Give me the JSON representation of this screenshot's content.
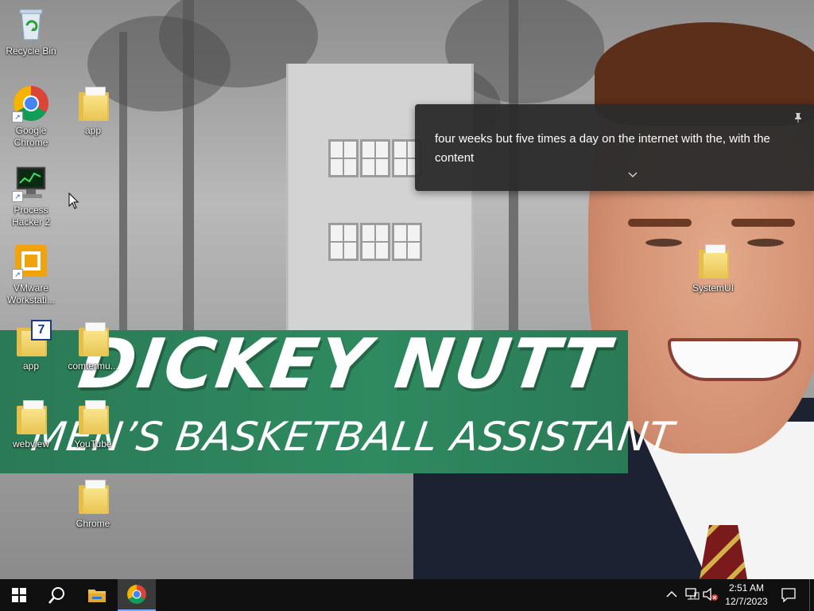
{
  "desktop": {
    "icons": [
      {
        "label": "Recycle Bin",
        "icon": "recycle-bin-icon"
      },
      {
        "label": "Google Chrome",
        "icon": "chrome-icon"
      },
      {
        "label": "app",
        "icon": "folder-icon"
      },
      {
        "label": "Process Hacker 2",
        "icon": "process-hacker-icon"
      },
      {
        "label": "VMware Workstati...",
        "icon": "vmware-icon"
      },
      {
        "label": "app",
        "icon": "archive-7z-icon"
      },
      {
        "label": "comtermu...",
        "icon": "folder-icon"
      },
      {
        "label": "webview",
        "icon": "folder-icon"
      },
      {
        "label": "YouTube",
        "icon": "folder-icon"
      },
      {
        "label": "Chrome",
        "icon": "folder-icon"
      },
      {
        "label": "SystemUI",
        "icon": "folder-icon"
      }
    ]
  },
  "wallpaper": {
    "title": "DICKEY NUTT",
    "subtitle": "MEN’S BASKETBALL ASSISTANT",
    "banner_color": "#2f8a60"
  },
  "notification": {
    "text": "four weeks but five times a day on the internet with the, with the content",
    "pin_icon": "pin-icon",
    "expand_icon": "chevron-down-icon"
  },
  "taskbar": {
    "start_icon": "windows-start-icon",
    "search_icon": "search-icon",
    "explorer_icon": "file-explorer-icon",
    "chrome_icon": "chrome-icon",
    "tray": {
      "show_hidden_icon": "chevron-up-icon",
      "network_icon": "network-icon",
      "volume_icon": "volume-muted-icon",
      "notification_icon": "action-center-icon"
    },
    "clock": {
      "time": "2:51 AM",
      "date": "12/7/2023"
    }
  }
}
